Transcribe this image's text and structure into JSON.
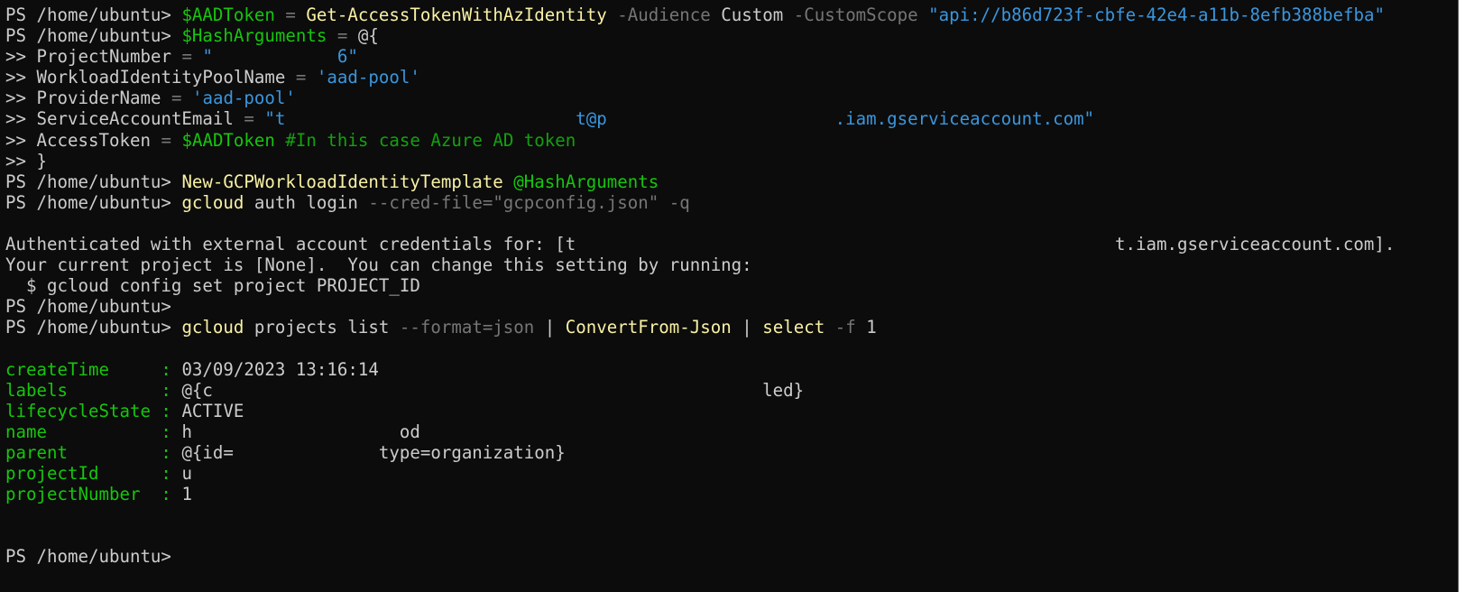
{
  "prompt": "PS /home/ubuntu> ",
  "cont": ">> ",
  "l0": {
    "var": "$AADToken",
    "eq": " = ",
    "cmd": "Get-AccessTokenWithAzIdentity",
    "p1": " -Audience ",
    "v1": "Custom",
    "p2": " -CustomScope ",
    "v2": "\"api://b86d723f-cbfe-42e4-a11b-8efb388befba\""
  },
  "l1": {
    "var": "$HashArguments",
    "eq": " = ",
    "rest": "@{"
  },
  "l2": {
    "key": "ProjectNumber",
    "eq": " = ",
    "val": "\"            6\""
  },
  "l3": {
    "key": "WorkloadIdentityPoolName",
    "eq": " = ",
    "val": "'aad-pool'"
  },
  "l4": {
    "key": "ProviderName",
    "eq": " = ",
    "val": "'aad-pool'"
  },
  "l5": {
    "key": "ServiceAccountEmail",
    "eq": " = ",
    "val": "\"t                            t@p                      .iam.gserviceaccount.com\""
  },
  "l6": {
    "key": "AccessToken",
    "eq": " = ",
    "var": "$AADToken",
    "comment": " #In this case Azure AD token"
  },
  "l7": {
    "rest": "}"
  },
  "l8": {
    "cmd": "New-GCPWorkloadIdentityTemplate",
    "arg": " @HashArguments"
  },
  "l9": {
    "cmd": "gcloud",
    "rest": " auth login",
    "param": " --cred-file=\"gcpconfig.json\" -q"
  },
  "l11": "Authenticated with external account credentials for: [t                                                    t.iam.gserviceaccount.com].",
  "l12": "Your current project is [None].  You can change this setting by running:",
  "l13": "  $ gcloud config set project PROJECT_ID",
  "l15": {
    "cmd": "gcloud",
    "rest": " projects list",
    "p1": " --format=json",
    "pipe1": " | ",
    "cmd2": "ConvertFrom-Json",
    "pipe2": " | ",
    "cmd3": "select",
    "p2": " -f",
    "v": " 1"
  },
  "props": [
    {
      "key": "createTime     : ",
      "val": "03/09/2023 13:16:14"
    },
    {
      "key": "labels         : ",
      "val": "@{c                                                     led}"
    },
    {
      "key": "lifecycleState : ",
      "val": "ACTIVE"
    },
    {
      "key": "name           : ",
      "val": "h                    od"
    },
    {
      "key": "parent         : ",
      "val": "@{id=              type=organization}"
    },
    {
      "key": "projectId      : ",
      "val": "u"
    },
    {
      "key": "projectNumber  : ",
      "val": "1"
    }
  ]
}
